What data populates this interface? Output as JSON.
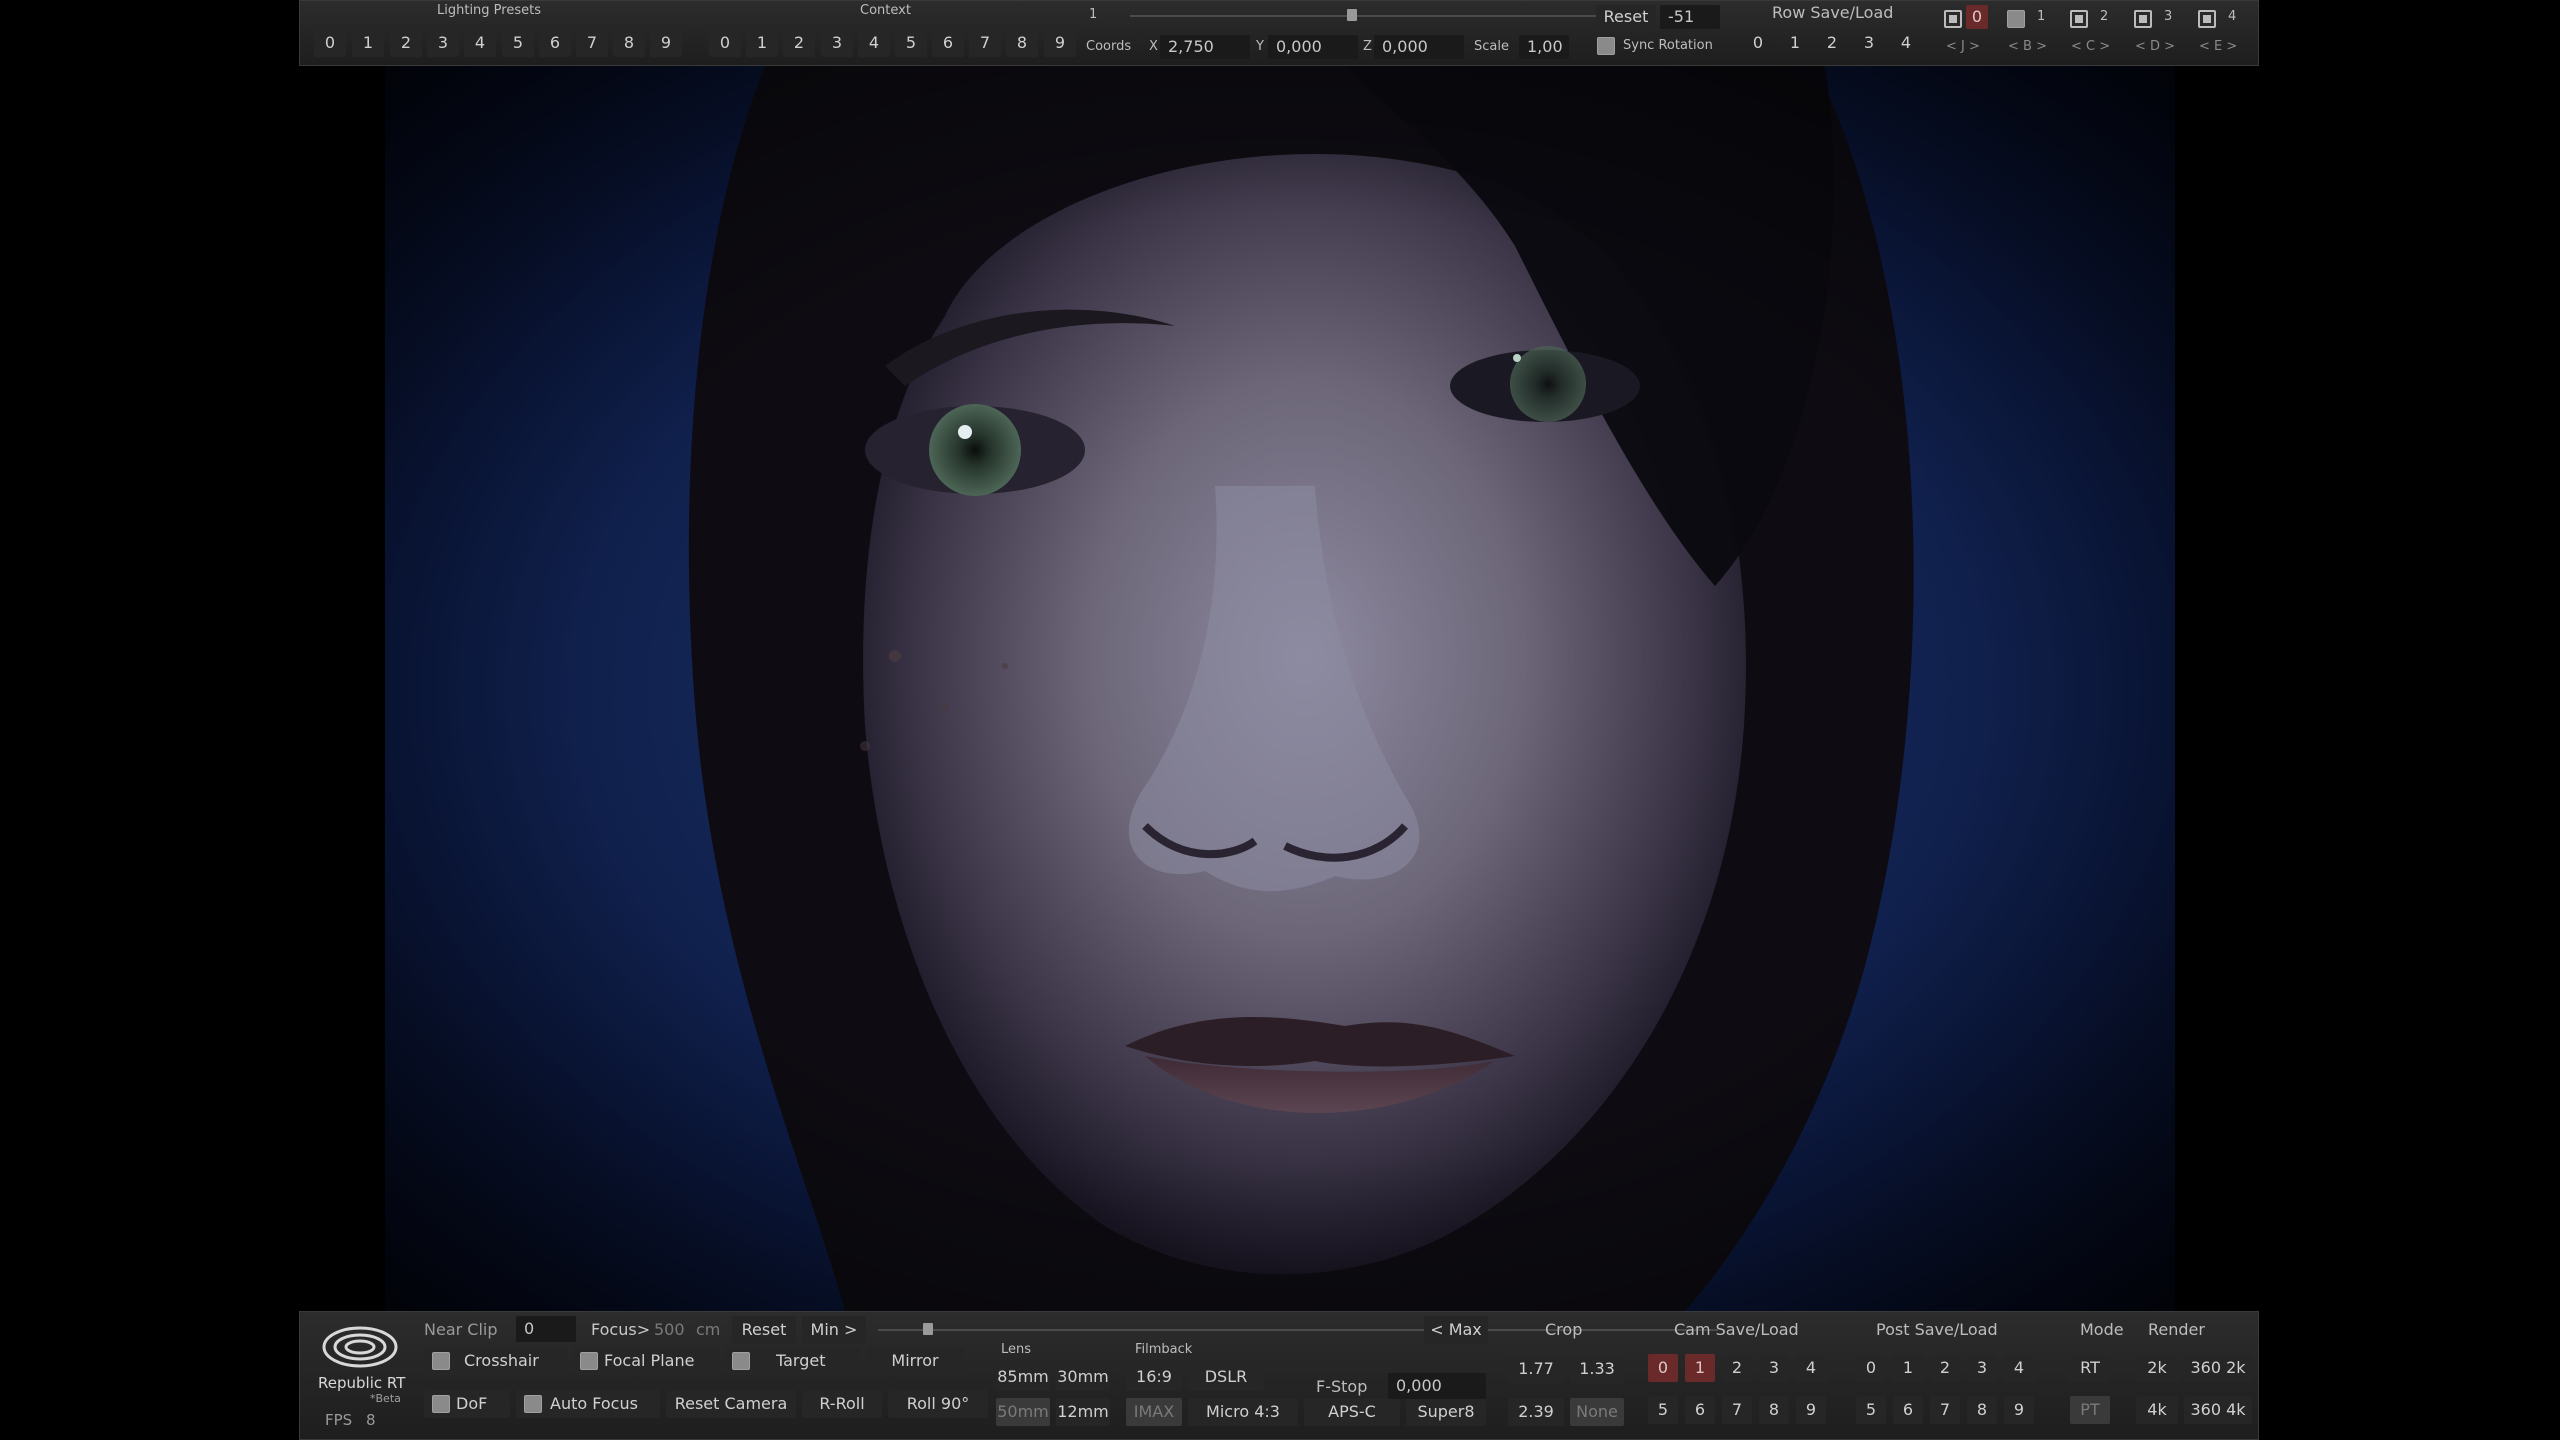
{
  "top": {
    "lighting_presets": {
      "title": "Lighting Presets",
      "buttons": [
        "0",
        "1",
        "2",
        "3",
        "4",
        "5",
        "6",
        "7",
        "8",
        "9"
      ]
    },
    "context": {
      "title": "Context",
      "buttons": [
        "0",
        "1",
        "2",
        "3",
        "4",
        "5",
        "6",
        "7",
        "8",
        "9"
      ]
    },
    "rotation_slider": {
      "label": "1"
    },
    "coords": {
      "label": "Coords",
      "x_label": "X",
      "x_value": "2,750",
      "y_label": "Y",
      "y_value": "0,000",
      "z_label": "Z",
      "z_value": "0,000"
    },
    "scale": {
      "label": "Scale",
      "value": "1,00"
    },
    "reset": {
      "label": "Reset",
      "value": "-51"
    },
    "sync_rotation": {
      "label": "Sync Rotation",
      "checked": false
    },
    "row_save_load": {
      "title": "Row Save/Load",
      "buttons": [
        "0",
        "1",
        "2",
        "3",
        "4"
      ]
    },
    "rows": [
      {
        "label": "0",
        "nav": "< J >",
        "active": true
      },
      {
        "label": "1",
        "nav": "< B >",
        "active": false
      },
      {
        "label": "2",
        "nav": "< C >",
        "active": false
      },
      {
        "label": "3",
        "nav": "< D >",
        "active": false
      },
      {
        "label": "4",
        "nav": "< E >",
        "active": false
      }
    ]
  },
  "bottom": {
    "logo": {
      "name": "Republic RT",
      "tag": "*Beta",
      "icon": "spiral-logo-icon"
    },
    "fps": {
      "label": "FPS",
      "value": "8"
    },
    "near_clip": {
      "label": "Near Clip",
      "value": "0"
    },
    "focus": {
      "label": "Focus>",
      "value": "500",
      "unit": "cm",
      "reset": "Reset"
    },
    "focus_slider": {
      "min": "Min  >",
      "max": "<  Max"
    },
    "toggles": {
      "crosshair": "Crosshair",
      "focal_plane": "Focal Plane",
      "target": "Target",
      "mirror": "Mirror",
      "dof": "DoF",
      "auto_focus": "Auto Focus",
      "reset_camera": "Reset Camera",
      "r_roll": "R-Roll",
      "roll_90": "Roll 90°"
    },
    "lens": {
      "title": "Lens",
      "row1": [
        "85mm",
        "30mm"
      ],
      "row2": [
        "50mm",
        "12mm"
      ],
      "selected": "50mm"
    },
    "filmback": {
      "title": "Filmback",
      "row1": [
        "16:9",
        "DSLR"
      ],
      "row2": [
        "IMAX",
        "Micro 4:3",
        "APS-C",
        "Super8"
      ],
      "selected": "IMAX"
    },
    "fstop": {
      "label": "F-Stop",
      "value": "0,000"
    },
    "crop": {
      "title": "Crop",
      "row1": [
        "1.77",
        "1.33"
      ],
      "row2": [
        "2.39",
        "None"
      ],
      "selected": "None"
    },
    "cam_save_load": {
      "title": "Cam Save/Load",
      "row1": [
        "0",
        "1",
        "2",
        "3",
        "4"
      ],
      "row2": [
        "5",
        "6",
        "7",
        "8",
        "9"
      ],
      "active": [
        "0",
        "1"
      ]
    },
    "post_save_load": {
      "title": "Post Save/Load",
      "row1": [
        "0",
        "1",
        "2",
        "3",
        "4"
      ],
      "row2": [
        "5",
        "6",
        "7",
        "8",
        "9"
      ]
    },
    "mode": {
      "title": "Mode",
      "options": [
        "RT",
        "PT"
      ],
      "selected": "PT"
    },
    "render": {
      "title": "Render",
      "row1": [
        "2k",
        "360 2k"
      ],
      "row2": [
        "4k",
        "360 4k"
      ]
    }
  },
  "colors": {
    "panel": "#262626",
    "active": "#6a2a2a",
    "background": "#000000",
    "viewport_blue": "#16295a"
  }
}
